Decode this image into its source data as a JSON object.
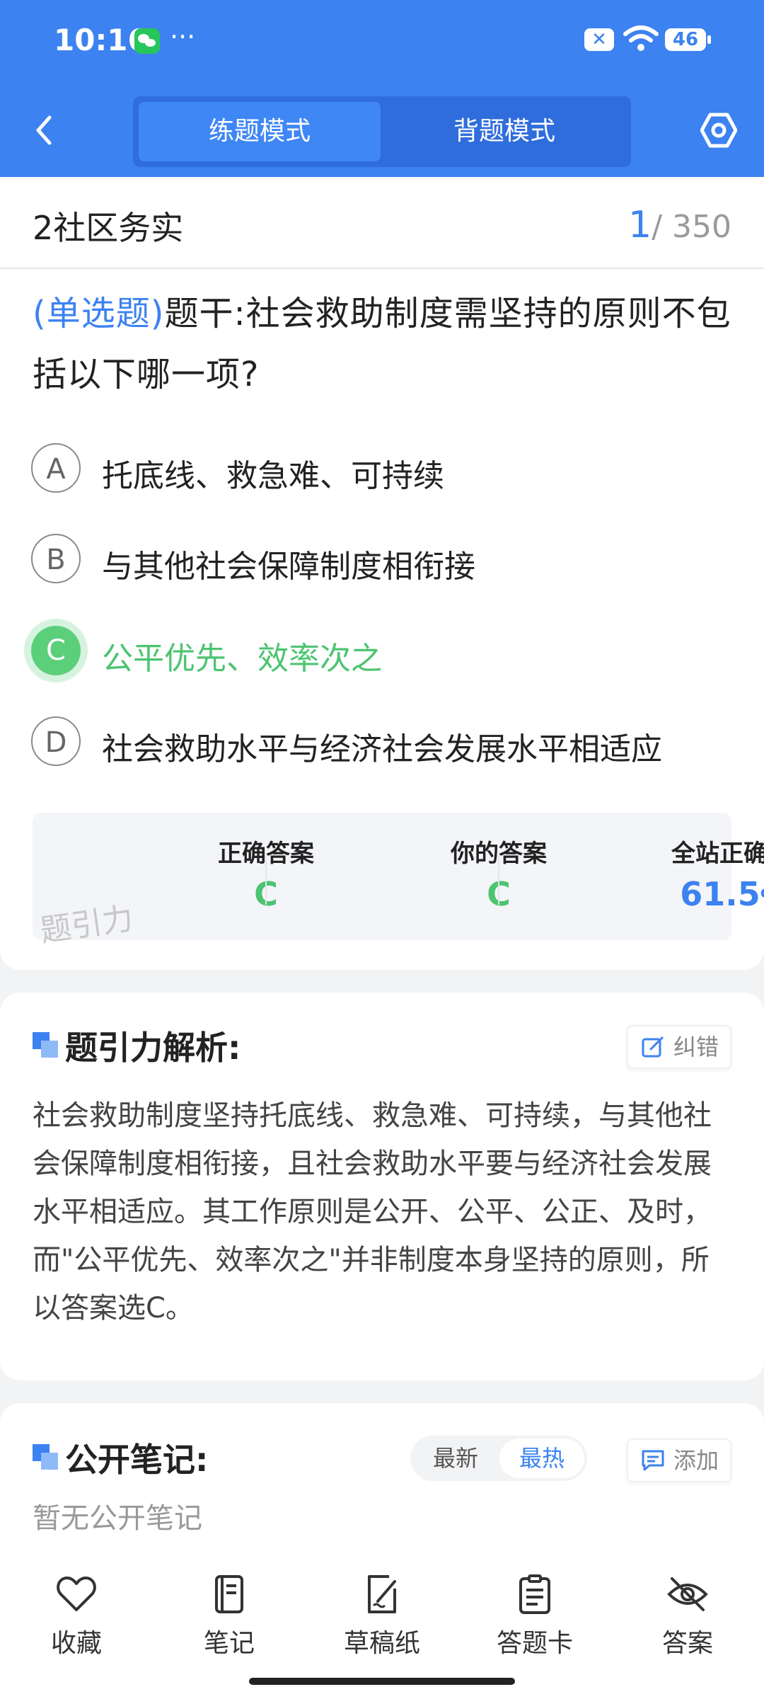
{
  "status_bar": {
    "time": "10:16",
    "more": "···",
    "battery": "46"
  },
  "header": {
    "tabs": [
      {
        "label": "练题模式",
        "active": true
      },
      {
        "label": "背题模式",
        "active": false
      }
    ]
  },
  "question": {
    "chapter": "2社区务实",
    "current": "1",
    "total": "/ 350",
    "type": "(单选题)",
    "stem": "题干:社会救助制度需坚持的原则不包括以下哪一项?",
    "options": [
      {
        "letter": "A",
        "text": "托底线、救急难、可持续"
      },
      {
        "letter": "B",
        "text": "与其他社会保障制度相衔接"
      },
      {
        "letter": "C",
        "text": "公平优先、效率次之"
      },
      {
        "letter": "D",
        "text": "社会救助水平与经济社会发展水平相适应"
      }
    ]
  },
  "stats": {
    "correct_label": "正确答案",
    "correct_value": "C",
    "yours_label": "你的答案",
    "yours_value": "C",
    "rate_label": "全站正确率",
    "rate_value": "61.5",
    "rate_unit": "%"
  },
  "watermark": "题引力",
  "analysis": {
    "title": "题引力解析:",
    "report_label": "纠错",
    "text": "社会救助制度坚持托底线、救急难、可持续，与其他社会保障制度相衔接，且社会救助水平要与经济社会发展水平相适应。其工作原则是公开、公平、公正、及时，而\"公平优先、效率次之\"并非制度本身坚持的原则，所以答案选C。"
  },
  "notes": {
    "title": "公开笔记:",
    "sort_latest": "最新",
    "sort_hot": "最热",
    "add_label": "添加",
    "empty": "暂无公开笔记"
  },
  "bottom_bar": [
    {
      "label": "收藏",
      "icon": "heart-icon"
    },
    {
      "label": "笔记",
      "icon": "notebook-icon"
    },
    {
      "label": "草稿纸",
      "icon": "draft-icon"
    },
    {
      "label": "答题卡",
      "icon": "answer-sheet-icon"
    },
    {
      "label": "答案",
      "icon": "eye-off-icon"
    }
  ],
  "colors": {
    "primary": "#3c82f0",
    "correct": "#4cc470",
    "background": "#f2f3f5"
  }
}
